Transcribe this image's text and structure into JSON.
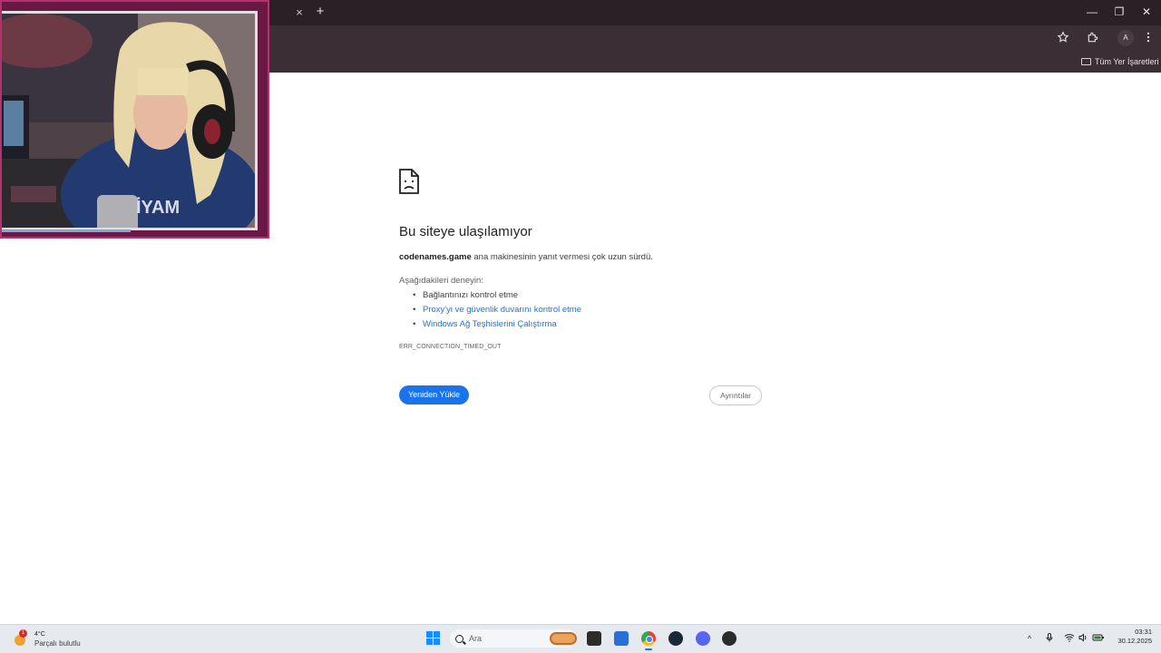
{
  "browser": {
    "tab_close_glyph": "×",
    "new_tab_glyph": "+",
    "window_controls": {
      "minimize": "—",
      "maximize": "❐",
      "close": "✕"
    },
    "toolbar": {
      "star_icon": "bookmark-star-icon",
      "extensions_icon": "puzzle-icon",
      "profile_initial": "A",
      "menu_icon": "kebab-menu-icon"
    },
    "bookmarks_bar": {
      "all_bookmarks_label": "Tüm Yer İşaretleri"
    },
    "colors": {
      "tabstrip": "#2a2025",
      "toolbar": "#3b2f35"
    }
  },
  "webcam_overlay": {
    "frame_color": "#b4326e",
    "border_color": "#6a1844"
  },
  "error_page": {
    "title": "Bu siteye ulaşılamıyor",
    "host": "codenames.game",
    "host_message": " ana makinesinin yanıt vermesi çok uzun sürdü.",
    "try_label": "Aşağıdakileri deneyin:",
    "suggestions": [
      "Bağlantınızı kontrol etme",
      "Proxy'yi ve güvenlik duvarını kontrol etme",
      "Windows Ağ Teşhislerini Çalıştırma"
    ],
    "error_code": "ERR_CONNECTION_TIMED_OUT",
    "reload_button": "Yeniden Yükle",
    "details_button": "Ayrıntılar",
    "accent_color": "#1a73e8"
  },
  "taskbar": {
    "weather": {
      "temperature": "4°C",
      "description": "Parçalı bulutlu",
      "badge": "1"
    },
    "search_placeholder": "Ara",
    "apps": [
      "start-icon",
      "file-explorer-icon",
      "store-icon",
      "chrome-icon",
      "steam-icon",
      "discord-icon",
      "app-icon"
    ],
    "tray": {
      "chevron": "^",
      "mic": "mic-icon",
      "wifi": "wifi-icon",
      "volume": "volume-icon",
      "battery": "battery-icon"
    },
    "clock": {
      "time": "03:31",
      "date": "30.12.2025"
    }
  }
}
